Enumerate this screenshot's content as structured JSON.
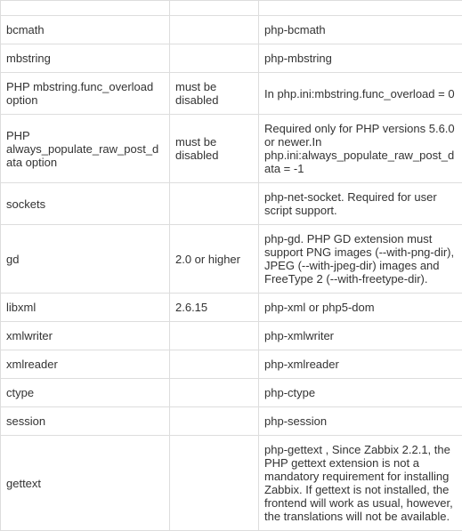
{
  "table": {
    "rows": [
      {
        "col1": "",
        "col2": "",
        "col3": ""
      },
      {
        "col1": "bcmath",
        "col2": "",
        "col3": "php-bcmath"
      },
      {
        "col1": "mbstring",
        "col2": "",
        "col3": "php-mbstring"
      },
      {
        "col1": "PHP mbstring.func_overload option",
        "col2": "must be disabled",
        "col3": "In php.ini:mbstring.func_overload = 0"
      },
      {
        "col1": "PHP always_populate_raw_post_data option",
        "col2": "must be disabled",
        "col3": "Required only for PHP versions 5.6.0 or newer.In php.ini:always_populate_raw_post_data = -1"
      },
      {
        "col1": "sockets",
        "col2": "",
        "col3": "php-net-socket. Required for user script support."
      },
      {
        "col1": "gd",
        "col2": "2.0 or higher",
        "col3": "php-gd. PHP GD extension must support PNG images (--with-png-dir), JPEG (--with-jpeg-dir) images and FreeType 2 (--with-freetype-dir)."
      },
      {
        "col1": "libxml",
        "col2": "2.6.15",
        "col3": "php-xml or php5-dom"
      },
      {
        "col1": "xmlwriter",
        "col2": "",
        "col3": "php-xmlwriter"
      },
      {
        "col1": "xmlreader",
        "col2": "",
        "col3": "php-xmlreader"
      },
      {
        "col1": "ctype",
        "col2": "",
        "col3": "php-ctype"
      },
      {
        "col1": "session",
        "col2": "",
        "col3": "php-session"
      },
      {
        "col1": "gettext",
        "col2": "",
        "col3": "php-gettext , Since Zabbix 2.2.1, the PHP gettext extension is not a mandatory requirement for installing Zabbix. If gettext is not installed, the frontend will work as usual, however, the translations will not be available."
      }
    ]
  }
}
